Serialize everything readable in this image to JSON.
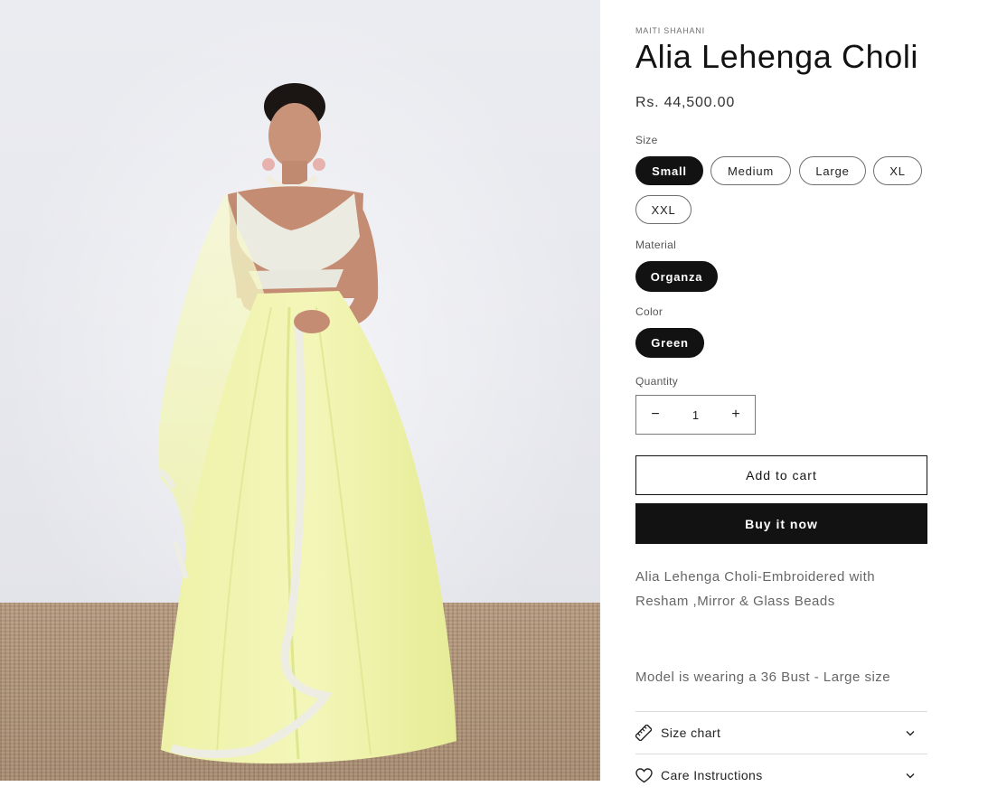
{
  "product": {
    "vendor": "MAITI SHAHANI",
    "title": "Alia Lehenga Choli",
    "price": "Rs. 44,500.00"
  },
  "options": {
    "size": {
      "label": "Size",
      "values": [
        "Small",
        "Medium",
        "Large",
        "XL",
        "XXL"
      ],
      "selected": "Small"
    },
    "material": {
      "label": "Material",
      "values": [
        "Organza"
      ],
      "selected": "Organza"
    },
    "color": {
      "label": "Color",
      "values": [
        "Green"
      ],
      "selected": "Green"
    }
  },
  "quantity": {
    "label": "Quantity",
    "value": "1",
    "minus": "−",
    "plus": "+"
  },
  "buttons": {
    "add_to_cart": "Add to cart",
    "buy_now": "Buy it now"
  },
  "description": {
    "line1": "Alia Lehenga Choli-Embroidered with Resham ,Mirror & Glass Beads",
    "line2": "Model is wearing a 36  Bust - Large size"
  },
  "accordions": [
    {
      "label": "Size chart",
      "icon": "ruler-icon"
    },
    {
      "label": "Care Instructions",
      "icon": "heart-icon"
    }
  ],
  "colors": {
    "text": "#121212",
    "button_dark": "#121212",
    "muted": "#666666",
    "border": "#dcdcdc"
  }
}
